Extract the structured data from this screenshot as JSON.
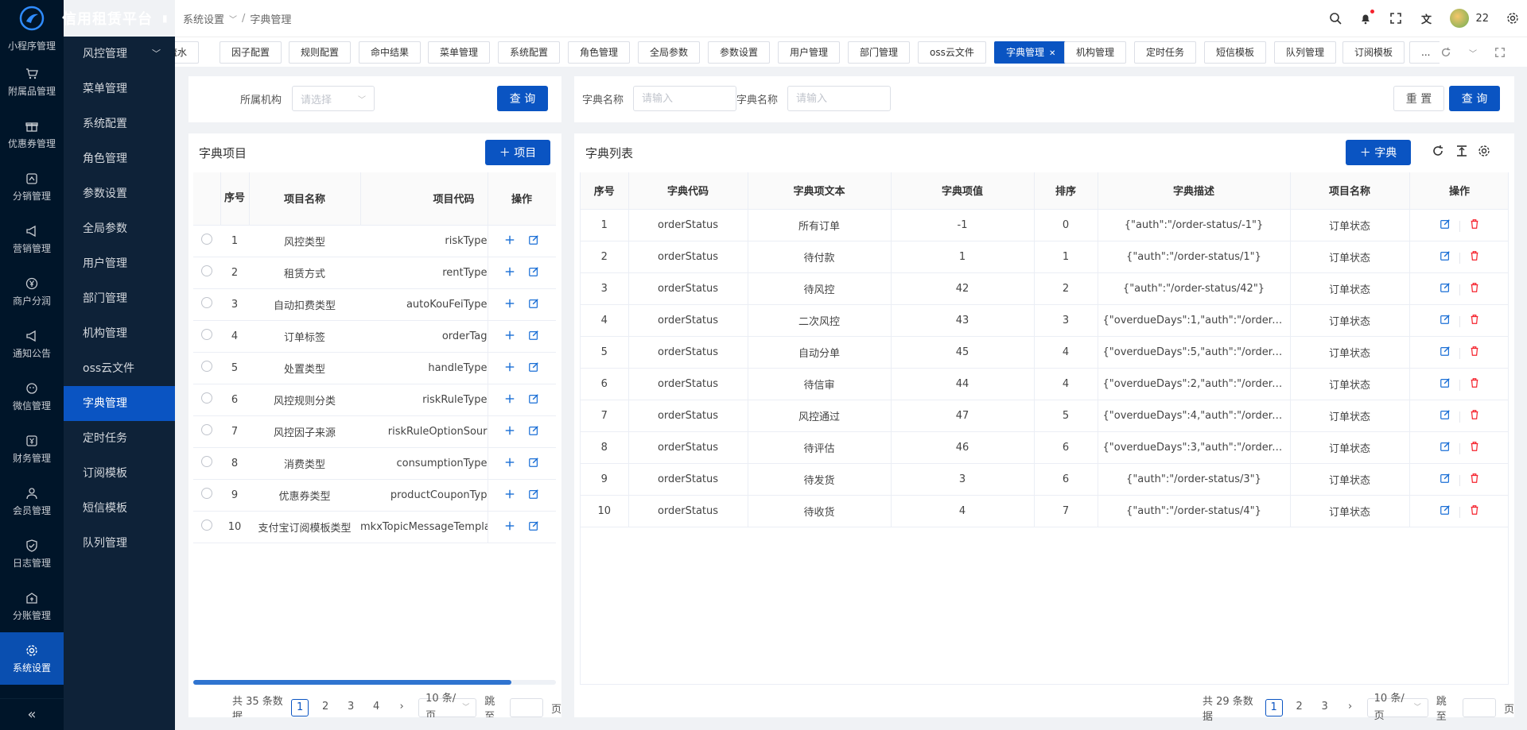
{
  "app": {
    "title": "信用租赁平台"
  },
  "rail": {
    "top_label": "小程序管理",
    "items": [
      {
        "label": "附属品管理",
        "icon": "cart-icon"
      },
      {
        "label": "优惠券管理",
        "icon": "gift-icon"
      },
      {
        "label": "分销管理",
        "icon": "share-icon"
      },
      {
        "label": "营销管理",
        "icon": "megaphone-icon"
      },
      {
        "label": "商户分润",
        "icon": "yen-icon"
      },
      {
        "label": "通知公告",
        "icon": "announce-icon"
      },
      {
        "label": "微信管理",
        "icon": "wechat-icon"
      },
      {
        "label": "财务管理",
        "icon": "finance-icon"
      },
      {
        "label": "会员管理",
        "icon": "member-icon"
      },
      {
        "label": "日志管理",
        "icon": "log-icon"
      },
      {
        "label": "分账管理",
        "icon": "split-icon"
      },
      {
        "label": "系统设置",
        "icon": "gear-icon"
      }
    ],
    "collapse": "«"
  },
  "sub_menu": {
    "items": [
      "风控管理",
      "菜单管理",
      "系统配置",
      "角色管理",
      "参数设置",
      "全局参数",
      "用户管理",
      "部门管理",
      "机构管理",
      "oss云文件",
      "字典管理",
      "定时任务",
      "订阅模板",
      "短信模板",
      "队列管理"
    ]
  },
  "breadcrumb": {
    "parent": "系统设置",
    "sep": "/",
    "current": "字典管理"
  },
  "user": {
    "name": "22"
  },
  "tabs": [
    "流水",
    "因子配置",
    "规则配置",
    "命中结果",
    "菜单管理",
    "系统配置",
    "角色管理",
    "全局参数",
    "参数设置",
    "用户管理",
    "部门管理",
    "oss云文件",
    "字典管理",
    "机构管理",
    "定时任务",
    "短信模板",
    "队列管理",
    "订阅模板",
    "..."
  ],
  "left_filter": {
    "org_label": "所属机构",
    "org_placeholder": "请选择",
    "query": "查 询"
  },
  "right_filter": {
    "name1_label": "字典名称",
    "name1_placeholder": "请输入",
    "name2_label": "字典名称",
    "name2_placeholder": "请输入",
    "reset": "重 置",
    "query": "查 询"
  },
  "dict_items": {
    "title": "字典项目",
    "add_button": "＋ 项目",
    "columns": [
      "序号",
      "项目名称",
      "项目代码",
      "操作"
    ],
    "rows": [
      {
        "no": "1",
        "name": "风控类型",
        "code": "riskType"
      },
      {
        "no": "2",
        "name": "租赁方式",
        "code": "rentType"
      },
      {
        "no": "3",
        "name": "自动扣费类型",
        "code": "autoKouFeiType"
      },
      {
        "no": "4",
        "name": "订单标签",
        "code": "orderTag"
      },
      {
        "no": "5",
        "name": "处置类型",
        "code": "handleType"
      },
      {
        "no": "6",
        "name": "风控规则分类",
        "code": "riskRuleType"
      },
      {
        "no": "7",
        "name": "风控因子来源",
        "code": "riskRuleOptionSour"
      },
      {
        "no": "8",
        "name": "消费类型",
        "code": "consumptionType"
      },
      {
        "no": "9",
        "name": "优惠券类型",
        "code": "productCouponTyp"
      },
      {
        "no": "10",
        "name": "支付宝订阅模板类型",
        "code": "mkxTopicMessageTempla"
      }
    ],
    "pager": {
      "total": "共 35 条数据",
      "pages": [
        "1",
        "2",
        "3",
        "4"
      ],
      "size": "10 条/页",
      "jump": "跳至",
      "unit": "页"
    }
  },
  "dict_list": {
    "title": "字典列表",
    "add_button": "＋ 字典",
    "columns": [
      "序号",
      "字典代码",
      "字典项文本",
      "字典项值",
      "排序",
      "字典描述",
      "项目名称",
      "操作"
    ],
    "rows": [
      {
        "no": "1",
        "code": "orderStatus",
        "text": "所有订单",
        "value": "-1",
        "sort": "0",
        "desc": "{\"auth\":\"/order-status/-1\"}",
        "project": "订单状态"
      },
      {
        "no": "2",
        "code": "orderStatus",
        "text": "待付款",
        "value": "1",
        "sort": "1",
        "desc": "{\"auth\":\"/order-status/1\"}",
        "project": "订单状态"
      },
      {
        "no": "3",
        "code": "orderStatus",
        "text": "待风控",
        "value": "42",
        "sort": "2",
        "desc": "{\"auth\":\"/order-status/42\"}",
        "project": "订单状态"
      },
      {
        "no": "4",
        "code": "orderStatus",
        "text": "二次风控",
        "value": "43",
        "sort": "3",
        "desc": "{\"overdueDays\":1,\"auth\":\"/order-st...",
        "project": "订单状态"
      },
      {
        "no": "5",
        "code": "orderStatus",
        "text": "自动分单",
        "value": "45",
        "sort": "4",
        "desc": "{\"overdueDays\":5,\"auth\":\"/order-st...",
        "project": "订单状态"
      },
      {
        "no": "6",
        "code": "orderStatus",
        "text": "待信审",
        "value": "44",
        "sort": "4",
        "desc": "{\"overdueDays\":2,\"auth\":\"/order-st...",
        "project": "订单状态"
      },
      {
        "no": "7",
        "code": "orderStatus",
        "text": "风控通过",
        "value": "47",
        "sort": "5",
        "desc": "{\"overdueDays\":4,\"auth\":\"/order-st...",
        "project": "订单状态"
      },
      {
        "no": "8",
        "code": "orderStatus",
        "text": "待评估",
        "value": "46",
        "sort": "6",
        "desc": "{\"overdueDays\":3,\"auth\":\"/order-st...",
        "project": "订单状态"
      },
      {
        "no": "9",
        "code": "orderStatus",
        "text": "待发货",
        "value": "3",
        "sort": "6",
        "desc": "{\"auth\":\"/order-status/3\"}",
        "project": "订单状态"
      },
      {
        "no": "10",
        "code": "orderStatus",
        "text": "待收货",
        "value": "4",
        "sort": "7",
        "desc": "{\"auth\":\"/order-status/4\"}",
        "project": "订单状态"
      }
    ],
    "pager": {
      "total": "共 29 条数据",
      "pages": [
        "1",
        "2",
        "3"
      ],
      "size": "10 条/页",
      "jump": "跳至",
      "unit": "页"
    }
  },
  "colors": {
    "primary": "#0a54c2",
    "rail_bg": "#001529",
    "danger": "#f5222d"
  }
}
